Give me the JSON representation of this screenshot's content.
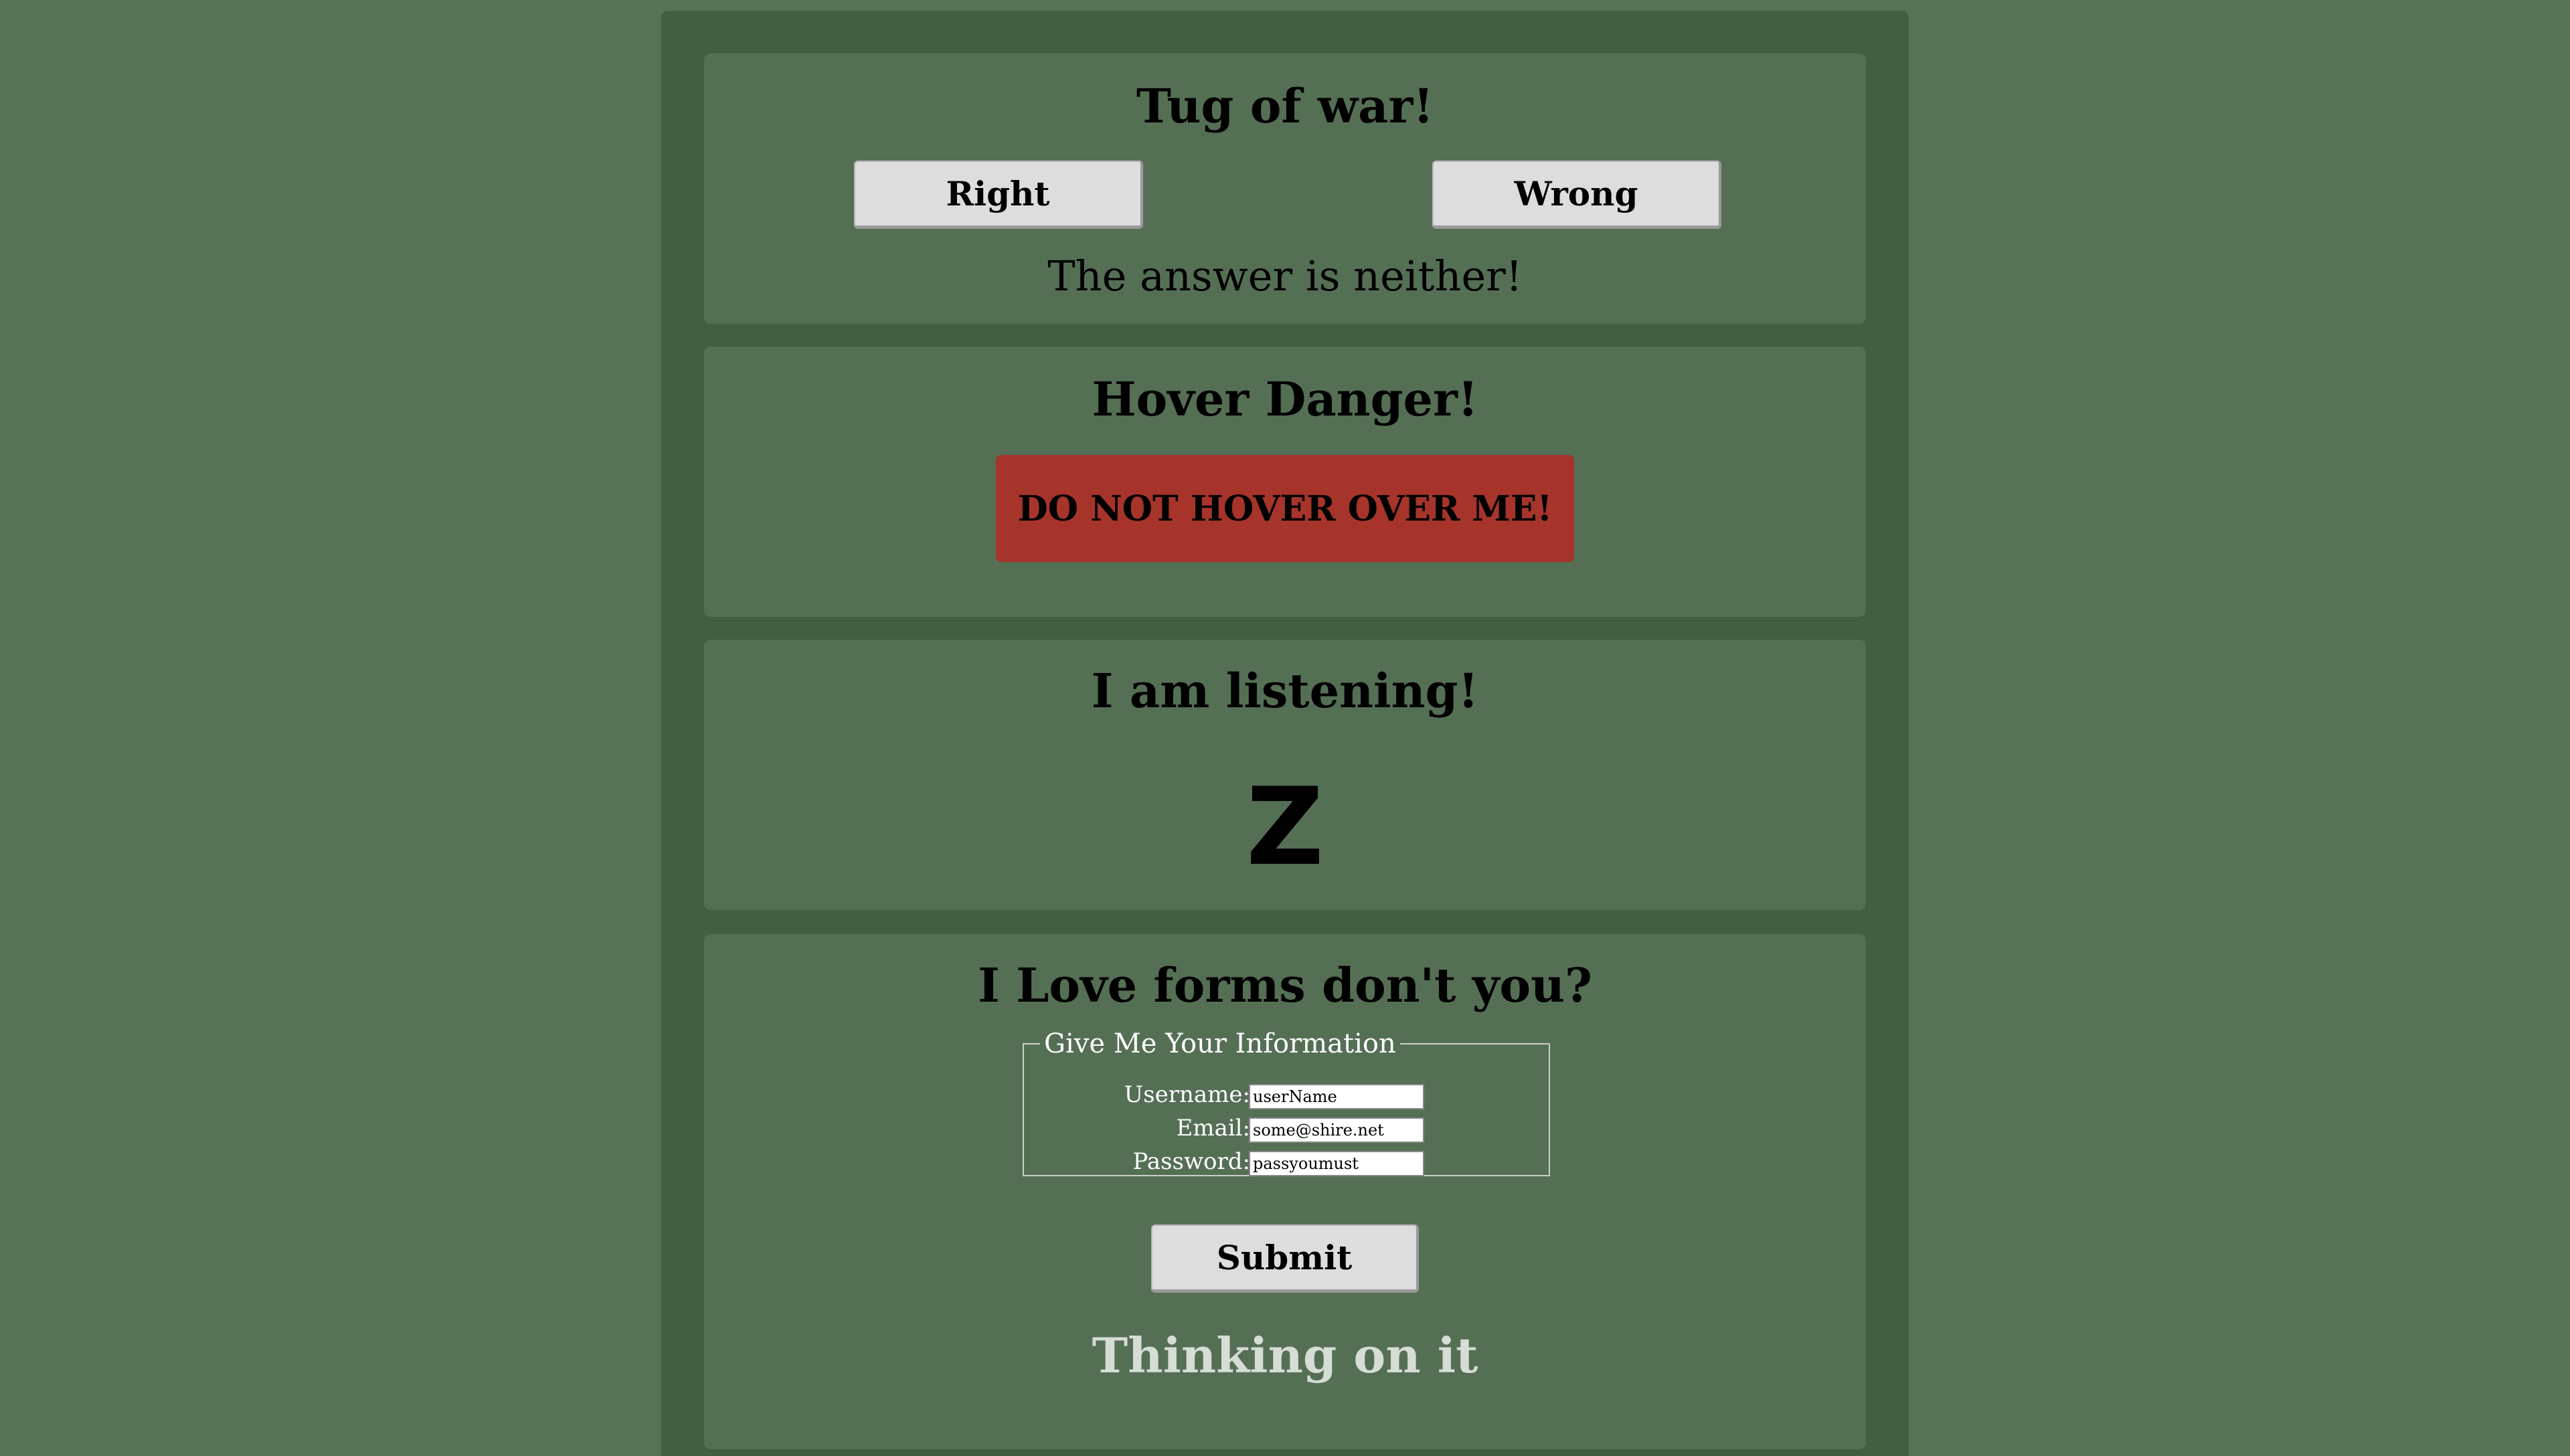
{
  "tug": {
    "title": "Tug of war!",
    "right_label": "Right",
    "wrong_label": "Wrong",
    "answer": "The answer is neither!"
  },
  "hover": {
    "title": "Hover Danger!",
    "button_label": "DO NOT HOVER OVER ME!"
  },
  "listening": {
    "title": "I am listening!",
    "key": "Z"
  },
  "forms": {
    "title": "I Love forms don't you?",
    "legend": "Give Me Your Information",
    "username_label": "Username:",
    "username_value": "userName",
    "email_label": "Email:",
    "email_value": "some@shire.net",
    "password_label": "Password:",
    "password_value": "passyoumust",
    "submit_label": "Submit",
    "status": "Thinking on it"
  },
  "colors": {
    "page_bg": "#567455",
    "container_bg": "#435e43",
    "panel_bg": "#556f55",
    "danger": "#a6342a",
    "button_bg": "#dddddd"
  }
}
